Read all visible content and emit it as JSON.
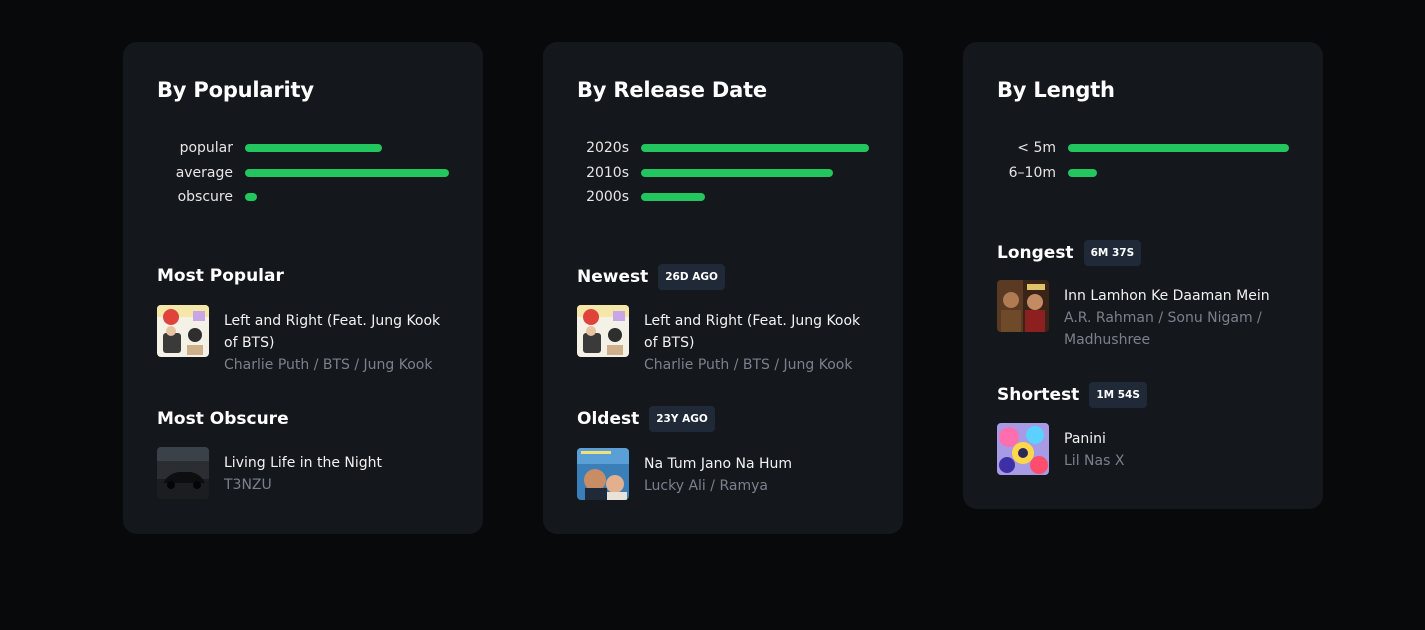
{
  "colors": {
    "background": "#08090b",
    "card": "#14171c",
    "bar": "#22c55e",
    "badge": "#1f2937",
    "muted_text": "#7a818c"
  },
  "popularity": {
    "title": "By Popularity",
    "bars": [
      {
        "label": "popular",
        "fraction": 0.67
      },
      {
        "label": "average",
        "fraction": 1.0
      },
      {
        "label": "obscure",
        "fraction": 0.06
      }
    ],
    "most_popular": {
      "heading": "Most Popular",
      "title": "Left and Right (Feat. Jung Kook of BTS)",
      "artists": "Charlie Puth / BTS / Jung Kook",
      "cover": "charlie-puth-cover"
    },
    "most_obscure": {
      "heading": "Most Obscure",
      "title": "Living Life in the Night",
      "artists": "T3NZU",
      "cover": "dark-car-cover"
    }
  },
  "release": {
    "title": "By Release Date",
    "bars": [
      {
        "label": "2020s",
        "fraction": 1.0
      },
      {
        "label": "2010s",
        "fraction": 0.84
      },
      {
        "label": "2000s",
        "fraction": 0.28
      }
    ],
    "newest": {
      "heading": "Newest",
      "badge": "26D AGO",
      "title": "Left and Right (Feat. Jung Kook of BTS)",
      "artists": "Charlie Puth / BTS / Jung Kook",
      "cover": "charlie-puth-cover"
    },
    "oldest": {
      "heading": "Oldest",
      "badge": "23Y AGO",
      "title": "Na Tum Jano Na Hum",
      "artists": "Lucky Ali / Ramya",
      "cover": "bollywood-poster-cover"
    }
  },
  "length": {
    "title": "By Length",
    "bars": [
      {
        "label": "< 5m",
        "fraction": 1.0
      },
      {
        "label": "6–10m",
        "fraction": 0.13
      }
    ],
    "longest": {
      "heading": "Longest",
      "badge": "6M 37S",
      "title": "Inn Lamhon Ke Daaman Mein",
      "artists": "A.R. Rahman / Sonu Nigam / Madhushree",
      "cover": "jodhaa-akbar-cover"
    },
    "shortest": {
      "heading": "Shortest",
      "badge": "1M 54S",
      "title": "Panini",
      "artists": "Lil Nas X",
      "cover": "colorful-art-cover"
    }
  }
}
